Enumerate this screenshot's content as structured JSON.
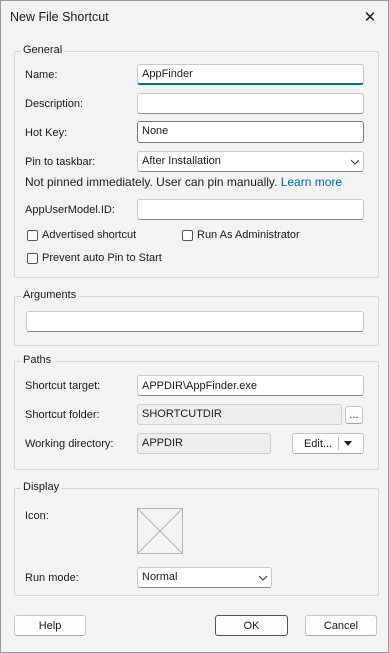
{
  "window": {
    "title": "New File Shortcut"
  },
  "general": {
    "legend": "General",
    "name_label": "Name:",
    "name_value": "AppFinder",
    "description_label": "Description:",
    "description_value": "",
    "hotkey_label": "Hot Key:",
    "hotkey_value": "None",
    "pin_label": "Pin to taskbar:",
    "pin_value": "After Installation",
    "pin_note": "Not pinned immediately. User can pin manually.",
    "learn_more": "Learn more",
    "aumid_label": "AppUserModel.ID:",
    "aumid_value": "",
    "advertised_label": "Advertised shortcut",
    "run_as_admin_label": "Run As Administrator",
    "prevent_pin_label": "Prevent auto Pin to Start"
  },
  "arguments": {
    "legend": "Arguments",
    "value": ""
  },
  "paths": {
    "legend": "Paths",
    "target_label": "Shortcut target:",
    "target_value": "APPDIR\\AppFinder.exe",
    "folder_label": "Shortcut folder:",
    "folder_value": "SHORTCUTDIR",
    "browse_label": "...",
    "working_label": "Working directory:",
    "working_value": "APPDIR",
    "edit_label": "Edit..."
  },
  "display": {
    "legend": "Display",
    "icon_label": "Icon:",
    "run_mode_label": "Run mode:",
    "run_mode_value": "Normal"
  },
  "buttons": {
    "help": "Help",
    "ok": "OK",
    "cancel": "Cancel"
  }
}
